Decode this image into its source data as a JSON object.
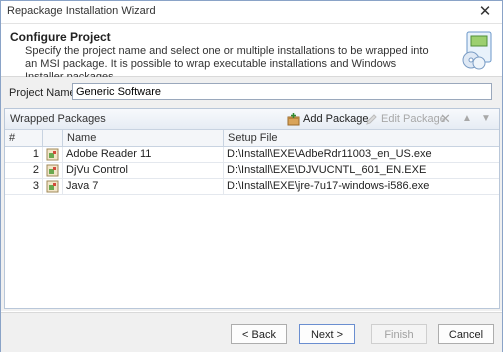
{
  "window": {
    "title": "Repackage Installation Wizard",
    "close_glyph": "✕"
  },
  "header": {
    "title": "Configure Project",
    "description": "Specify the project name and select one or multiple installations to be wrapped into an MSI package. It is possible to wrap executable installations and Windows Installer packages.",
    "icon": "install-wizard-icon"
  },
  "project": {
    "label": "Project Name:",
    "value": "Generic Software"
  },
  "packages_panel": {
    "title": "Wrapped Packages",
    "toolbar": {
      "add_label": "Add Package",
      "edit_label": "Edit Package",
      "remove_glyph": "✕",
      "up_glyph": "▲",
      "down_glyph": "▼"
    },
    "columns": {
      "num": "#",
      "name": "Name",
      "setup": "Setup File"
    },
    "rows": [
      {
        "num": "1",
        "name": "Adobe Reader 11",
        "setup": "D:\\Install\\EXE\\AdbeRdr11003_en_US.exe"
      },
      {
        "num": "2",
        "name": "DjVu Control",
        "setup": "D:\\Install\\EXE\\DJVUCNTL_601_EN.EXE"
      },
      {
        "num": "3",
        "name": "Java 7",
        "setup": "D:\\Install\\EXE\\jre-7u17-windows-i586.exe"
      }
    ]
  },
  "footer": {
    "back": "< Back",
    "next": "Next >",
    "finish": "Finish",
    "cancel": "Cancel"
  },
  "colors": {
    "accent": "#6a8ed0",
    "panel_border": "#b9c7d9",
    "disabled": "#a8a8a8"
  }
}
